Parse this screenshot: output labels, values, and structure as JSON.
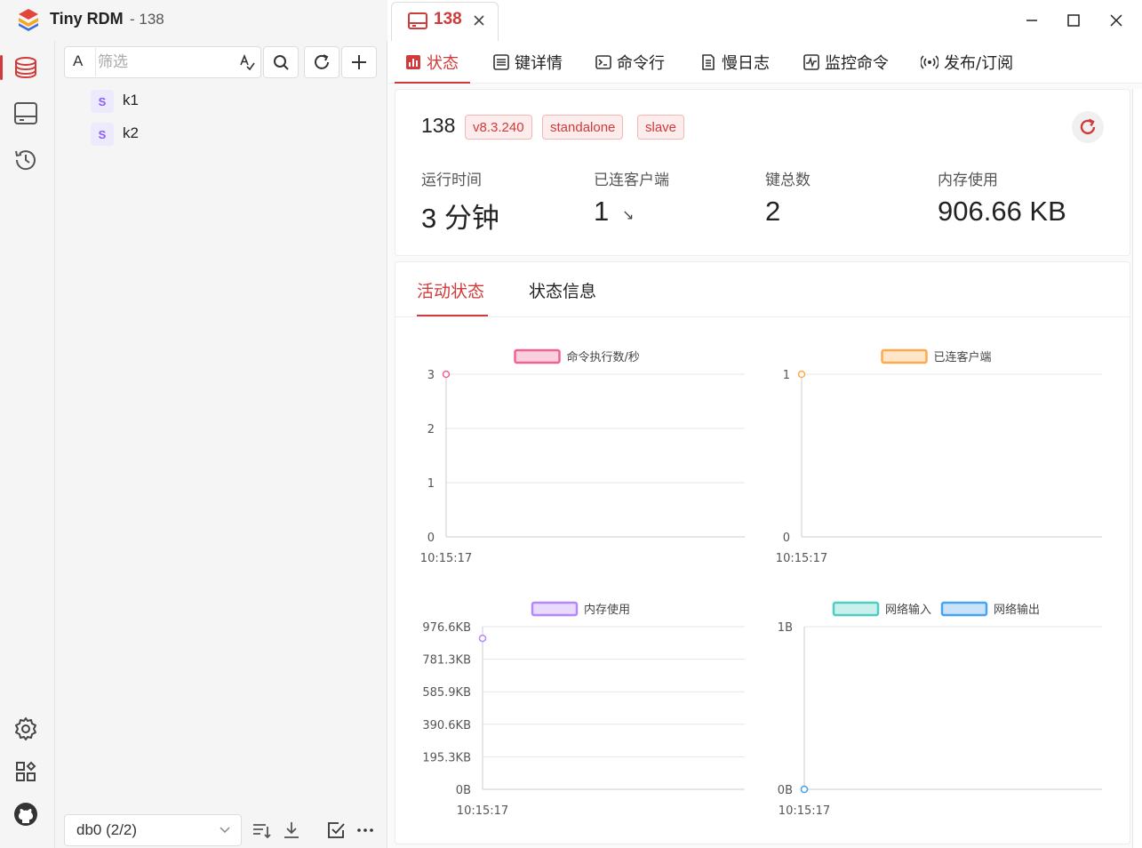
{
  "window": {
    "app_name": "Tiny RDM",
    "subtitle": "- 138",
    "tab_label": "138"
  },
  "sidebar": {
    "filter_prefix": "A",
    "filter_placeholder": "筛选",
    "keys": [
      {
        "type": "S",
        "name": "k1"
      },
      {
        "type": "S",
        "name": "k2"
      }
    ],
    "db_select": "db0 (2/2)"
  },
  "tabs": {
    "status": "状态",
    "key_detail": "键详情",
    "cli": "命令行",
    "slow_log": "慢日志",
    "monitor": "监控命令",
    "pubsub": "发布/订阅"
  },
  "server": {
    "name": "138",
    "tags": [
      "v8.3.240",
      "standalone",
      "slave"
    ],
    "stats": [
      {
        "label": "运行时间",
        "value": "3 分钟"
      },
      {
        "label": "已连客户端",
        "value": "1",
        "trend": "↘"
      },
      {
        "label": "键总数",
        "value": "2"
      },
      {
        "label": "内存使用",
        "value": "906.66 KB"
      }
    ]
  },
  "chart_tabs": {
    "active": "活动状态",
    "info": "状态信息"
  },
  "colors": {
    "accent": "#d03a3a",
    "ops": "#f06292",
    "clients": "#ffa94d",
    "memory": "#b388ff",
    "net_in": "#4ecdc4",
    "net_out": "#4aa3f0"
  },
  "chart_data": [
    {
      "type": "line",
      "x": [
        "10:15:17"
      ],
      "series": [
        {
          "name": "命令执行数/秒",
          "values": [
            3
          ]
        }
      ],
      "ylim": [
        0,
        3
      ],
      "yticks": [
        "0",
        "1",
        "2",
        "3"
      ],
      "legend": "top"
    },
    {
      "type": "line",
      "x": [
        "10:15:17"
      ],
      "series": [
        {
          "name": "已连客户端",
          "values": [
            1
          ]
        }
      ],
      "ylim": [
        0,
        1
      ],
      "yticks": [
        "0",
        "1"
      ],
      "legend": "top"
    },
    {
      "type": "line",
      "x": [
        "10:15:17"
      ],
      "series": [
        {
          "name": "内存使用",
          "values": [
            906.66
          ]
        }
      ],
      "ylim": [
        0,
        976.6
      ],
      "yticks": [
        "0B",
        "195.3KB",
        "390.6KB",
        "585.9KB",
        "781.3KB",
        "976.6KB"
      ],
      "unit": "KB",
      "legend": "top"
    },
    {
      "type": "line",
      "x": [
        "10:15:17"
      ],
      "series": [
        {
          "name": "网络输入",
          "values": [
            0
          ]
        },
        {
          "name": "网络输出",
          "values": [
            0
          ]
        }
      ],
      "ylim": [
        0,
        1
      ],
      "yticks": [
        "0B",
        "1B"
      ],
      "legend": "top"
    }
  ]
}
